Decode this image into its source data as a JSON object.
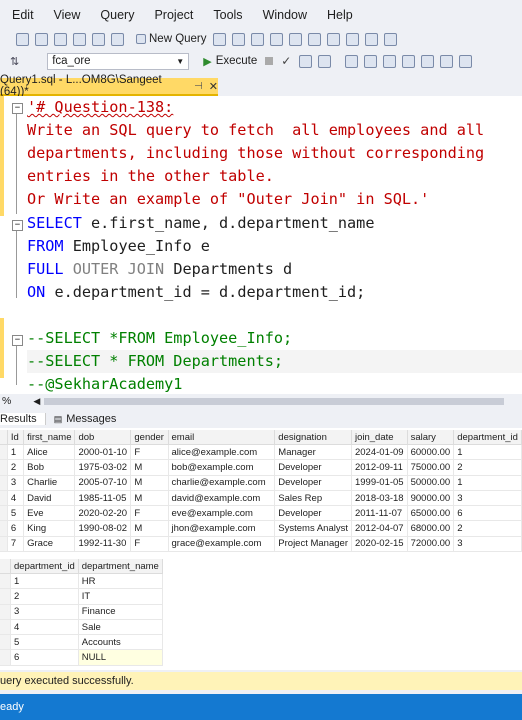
{
  "menu": [
    "Edit",
    "View",
    "Query",
    "Project",
    "Tools",
    "Window",
    "Help"
  ],
  "toolbar": {
    "new_query": "New Query",
    "database": "fca_ore",
    "execute": "Execute"
  },
  "tab": {
    "label": "Query1.sql - L...OM8G\\Sangeet (64))*",
    "close": "✕"
  },
  "editor": {
    "lines": [
      "'# Question-138:",
      "Write an SQL query to fetch  all employees and all",
      "departments, including those without corresponding",
      "entries in the other table.",
      "Or Write an example of \"Outer Join\" in SQL.'"
    ],
    "sql1": {
      "kw1": "SELECT",
      "rest": " e.first_name, d.department_name"
    },
    "sql2": {
      "kw": "FROM",
      "rest": " Employee_Info e"
    },
    "sql3": {
      "kw1": "FULL",
      "kw2": " OUTER JOIN",
      "rest": " Departments d"
    },
    "sql4": {
      "kw": "ON",
      "rest": " e.department_id = d.department_id;"
    },
    "c1": "--SELECT *FROM Employee_Info;",
    "c2": "--SELECT * FROM Departments;",
    "c3": "--@SekharAcademy1"
  },
  "zoom": "%",
  "results_tabs": {
    "results": "Results",
    "messages": "Messages"
  },
  "employees": {
    "columns": [
      "Id",
      "first_name",
      "dob",
      "gender",
      "email",
      "designation",
      "join_date",
      "salary",
      "department_id"
    ],
    "rows": [
      [
        "1",
        "Alice",
        "2000-01-10",
        "F",
        "alice@example.com",
        "Manager",
        "2024-01-09",
        "60000.00",
        "1"
      ],
      [
        "2",
        "Bob",
        "1975-03-02",
        "M",
        "bob@example.com",
        "Developer",
        "2012-09-11",
        "75000.00",
        "2"
      ],
      [
        "3",
        "Charlie",
        "2005-07-10",
        "M",
        "charlie@example.com",
        "Developer",
        "1999-01-05",
        "50000.00",
        "1"
      ],
      [
        "4",
        "David",
        "1985-11-05",
        "M",
        "david@example.com",
        "Sales Rep",
        "2018-03-18",
        "90000.00",
        "3"
      ],
      [
        "5",
        "Eve",
        "2020-02-20",
        "F",
        "eve@example.com",
        "Developer",
        "2011-11-07",
        "65000.00",
        "6"
      ],
      [
        "6",
        "King",
        "1990-08-02",
        "M",
        "jhon@example.com",
        "Systems Analyst",
        "2012-04-07",
        "68000.00",
        "2"
      ],
      [
        "7",
        "Grace",
        "1992-11-30",
        "F",
        "grace@example.com",
        "Project Manager",
        "2020-02-15",
        "72000.00",
        "3"
      ]
    ]
  },
  "departments": {
    "columns": [
      "department_id",
      "department_name"
    ],
    "rows": [
      [
        "1",
        "HR"
      ],
      [
        "2",
        "IT"
      ],
      [
        "3",
        "Finance"
      ],
      [
        "4",
        "Sale"
      ],
      [
        "5",
        "Accounts"
      ],
      [
        "6",
        "NULL"
      ]
    ]
  },
  "status": "uery executed successfully.",
  "statusbar": "eady"
}
